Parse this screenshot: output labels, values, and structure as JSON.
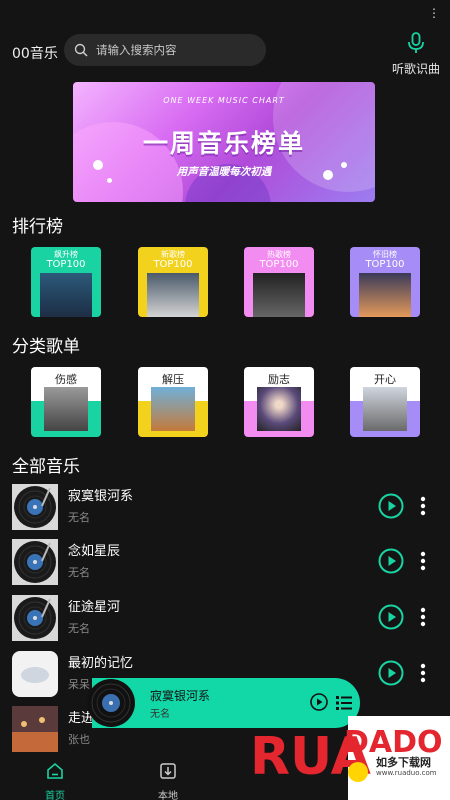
{
  "status": {
    "dots": "⋮"
  },
  "app": {
    "title": "00音乐"
  },
  "search": {
    "placeholder": "请输入搜索内容"
  },
  "voice": {
    "label": "听歌识曲",
    "icon": "microphone-icon",
    "color": "#19d3a2"
  },
  "banner": {
    "subtitle": "ONE WEEK MUSIC CHART",
    "title": "一周音乐榜单",
    "tagline": "用声音温暖每次初遇"
  },
  "sections": {
    "ranking": "排行榜",
    "categories": "分类歌单",
    "all_music": "全部音乐"
  },
  "rankings": [
    {
      "title": "飙升榜",
      "sub": "TOP100",
      "color": "#19d3a2"
    },
    {
      "title": "新歌榜",
      "sub": "TOP100",
      "color": "#f3d21e"
    },
    {
      "title": "热歌榜",
      "sub": "TOP100",
      "color": "#f38cf0"
    },
    {
      "title": "怀旧榜",
      "sub": "TOP100",
      "color": "#a58cf7"
    }
  ],
  "categories": [
    {
      "label": "伤感",
      "color": "#19d3a2"
    },
    {
      "label": "解压",
      "color": "#f3d21e"
    },
    {
      "label": "励志",
      "color": "#f38cf0"
    },
    {
      "label": "开心",
      "color": "#a58cf7"
    }
  ],
  "songs": [
    {
      "name": "寂寞银河系",
      "artist": "无名"
    },
    {
      "name": "念如星辰",
      "artist": "无名"
    },
    {
      "name": "征途星河",
      "artist": "无名"
    },
    {
      "name": "最初的记忆",
      "artist": "呆呆"
    },
    {
      "name": "走进",
      "artist": "张也"
    }
  ],
  "player": {
    "name": "寂寞银河系",
    "artist": "无名",
    "color": "#12d8a8"
  },
  "nav": [
    {
      "label": "首页",
      "icon": "home-icon",
      "active": true
    },
    {
      "label": "本地",
      "icon": "download-icon",
      "active": false
    }
  ],
  "watermark": {
    "brand": "RUANDADO",
    "cn": "如多下载网",
    "url": "www.ruaduo.com"
  },
  "accent": "#19d3a2"
}
